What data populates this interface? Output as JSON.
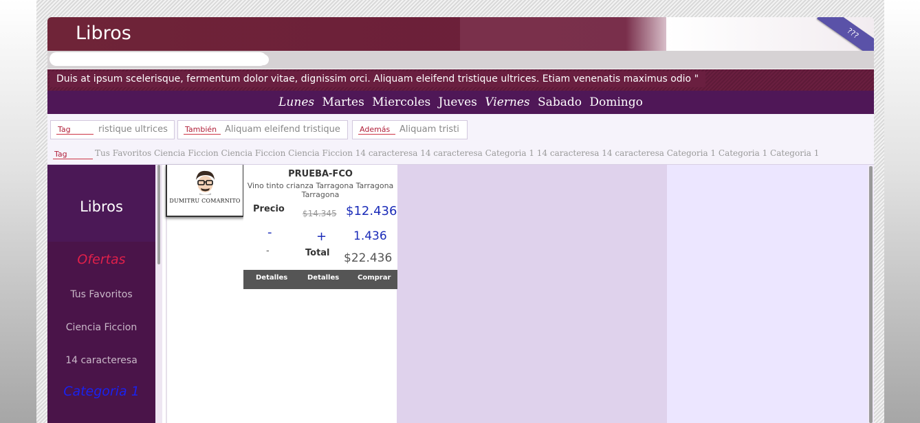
{
  "header": {
    "title": "Libros",
    "ribbon": "???"
  },
  "search": {
    "value": "",
    "placeholder": ""
  },
  "marquee": {
    "text": "Duis at ipsum scelerisque, fermentum dolor vitae, dignissim orci. Aliquam eleifend tristique ultrices. Etiam venenatis maximus odio \""
  },
  "days": [
    "Lunes",
    "Martes",
    "Miercoles",
    "Jueves",
    "Viernes",
    "Sabado",
    "Domingo"
  ],
  "tag_filters": [
    {
      "label": "Tag",
      "text": "ristique ultrices"
    },
    {
      "label": "También",
      "text": "Aliquam eleifend tristique"
    },
    {
      "label": "Además",
      "text": "Aliquam tristi"
    }
  ],
  "tag_line": {
    "label": "Tag",
    "text": "Tus Favoritos Ciencia Ficcion Ciencia Ficcion Ciencia Ficcion 14 caracteresa 14 caracteresa Categoria 1 14 caracteresa 14 caracteresa Categoria 1 Categoria 1 Categoria 1"
  },
  "sidebar": {
    "brand": "Libros",
    "items": [
      {
        "label": "Ofertas",
        "color": "#e0204a"
      },
      {
        "label": "Tus Favoritos",
        "color": "#c9b8c8"
      },
      {
        "label": "Ciencia Ficcion",
        "color": "#c9b8c8"
      },
      {
        "label": "14 caracteresa",
        "color": "#c9b8c8"
      },
      {
        "label": "Categoria 1",
        "color": "#1a22ee"
      }
    ]
  },
  "product": {
    "logo_text": "DUMITRU COMARNITO",
    "name": "PRUEBA-FCO",
    "description": "Vino tinto crianza Tarragona Tarragona Tarragona",
    "price_label": "Precio",
    "old_price": "$14.345",
    "price": "$12.436",
    "minus": "-",
    "plus": "+",
    "quantity": "1.436",
    "minus2": "-",
    "total_label": "Total",
    "total": "$22.436",
    "buttons": [
      "Detalles",
      "Detalles",
      "Comprar"
    ]
  }
}
